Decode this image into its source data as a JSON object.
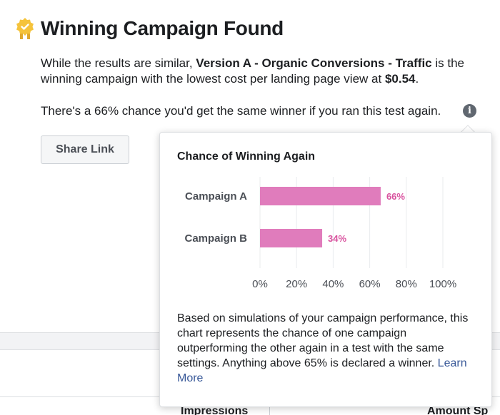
{
  "header": {
    "title": "Winning Campaign Found",
    "badge_icon": "award-badge-icon",
    "badge_color": "#f5c33b"
  },
  "summary": {
    "part1": "While the results are similar, ",
    "campaign": "Version A - Organic Conversions - Traffic",
    "part2": " is the winning campaign with the lowest cost per landing page view at ",
    "cost": "$0.54",
    "part3": "."
  },
  "chance_text": "There's a 66% chance you'd get the same winner if you ran this test again.",
  "info_icon": "info-icon",
  "share_button_label": "Share Link",
  "table_headers": [
    "Impressions",
    "Amount Sp"
  ],
  "popover": {
    "title": "Chance of Winning Again",
    "description": "Based on simulations of your campaign performance, this chart represents the chance of one campaign outperforming the other again in a test with the same settings. Anything above 65% is declared a winner. ",
    "link_label": "Learn More"
  },
  "chart_data": {
    "type": "bar",
    "orientation": "horizontal",
    "title": "Chance of Winning Again",
    "categories": [
      "Campaign A",
      "Campaign B"
    ],
    "values": [
      66,
      34
    ],
    "value_labels": [
      "66%",
      "34%"
    ],
    "x_ticks": [
      "0%",
      "20%",
      "40%",
      "60%",
      "80%",
      "100%"
    ],
    "xlim": [
      0,
      100
    ],
    "grid": true,
    "bar_color": "#e07cbc",
    "label_color": "#d9539f",
    "grid_color": "#e9ebee"
  }
}
